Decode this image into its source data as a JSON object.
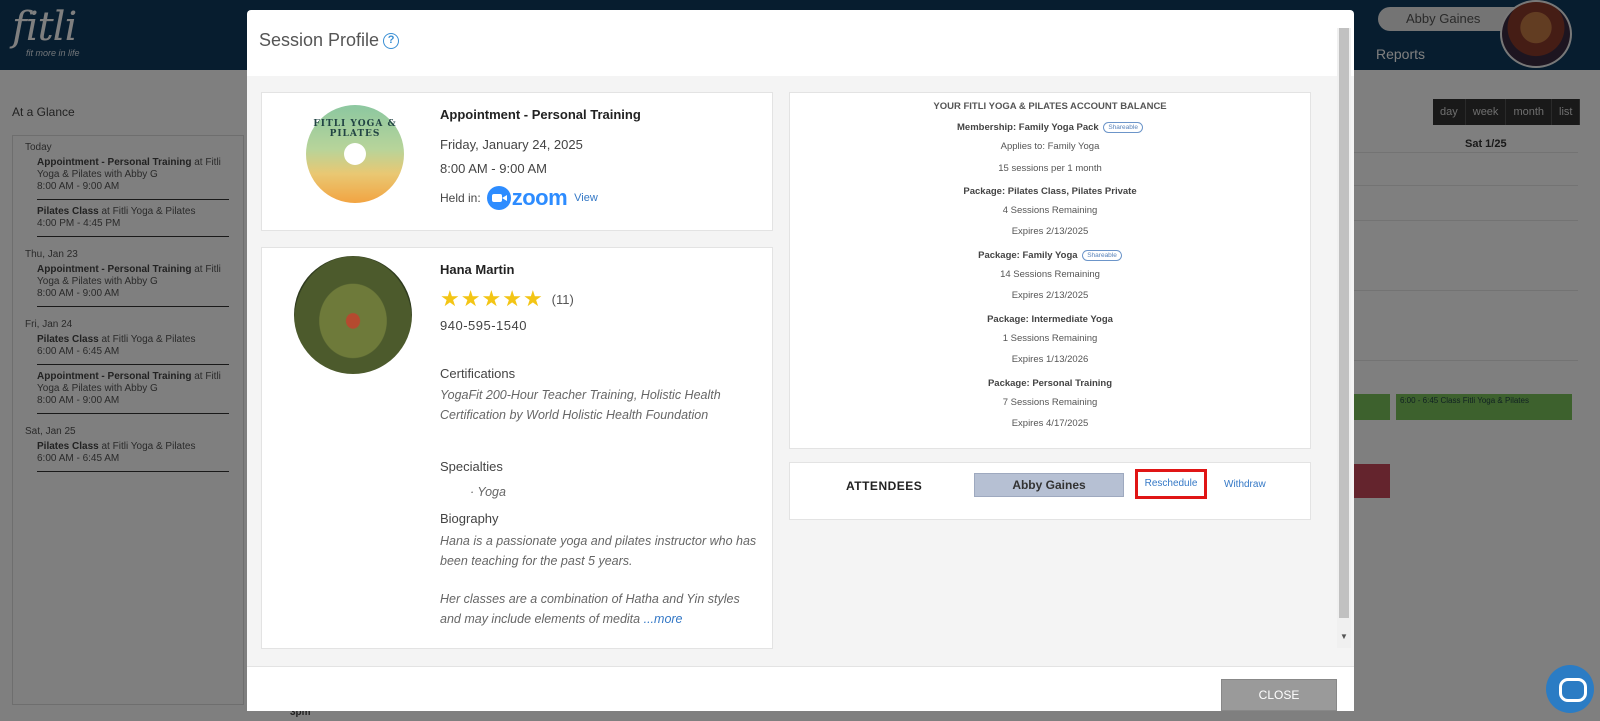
{
  "background": {
    "logo": "fitli",
    "logo_tagline": "fit more in life",
    "user_name": "Abby Gaines",
    "nav_reports": "Reports",
    "at_a_glance": "At a Glance",
    "view_buttons": [
      "day",
      "week",
      "month",
      "list"
    ],
    "calendar_day_header": "Sat 1/25",
    "sidebar": [
      {
        "day": "Today",
        "items": [
          {
            "title": "Appointment - Personal Training",
            "rest": "at Fitli Yoga & Pilates with Abby G",
            "time": "8:00 AM - 9:00 AM"
          },
          {
            "title": "Pilates Class",
            "rest": "at Fitli Yoga & Pilates",
            "time": "4:00 PM - 4:45 PM"
          }
        ]
      },
      {
        "day": "Thu, Jan 23",
        "items": [
          {
            "title": "Appointment - Personal Training",
            "rest": "at Fitli Yoga & Pilates with Abby G",
            "time": "8:00 AM - 9:00 AM"
          }
        ]
      },
      {
        "day": "Fri, Jan 24",
        "items": [
          {
            "title": "Pilates Class",
            "rest": "at Fitli Yoga & Pilates",
            "time": "6:00 AM - 6:45 AM"
          },
          {
            "title": "Appointment - Personal Training",
            "rest": "at Fitli Yoga & Pilates with Abby G",
            "time": "8:00 AM - 9:00 AM"
          }
        ]
      },
      {
        "day": "Sat, Jan 25",
        "items": [
          {
            "title": "Pilates Class",
            "rest": "at Fitli Yoga & Pilates",
            "time": "6:00 AM - 6:45 AM"
          }
        ]
      }
    ],
    "event_green_text": "6:00 - 6:45 Class Fitli Yoga & Pilates",
    "time_label": "3pm"
  },
  "modal": {
    "title": "Session Profile",
    "help_icon": "?",
    "session": {
      "logo_text": "FITLI YOGA & PILATES",
      "title": "Appointment - Personal Training",
      "date": "Friday, January 24, 2025",
      "time": "8:00 AM - 9:00 AM",
      "held_in_label": "Held in:",
      "platform": "zoom",
      "view_label": "View"
    },
    "instructor": {
      "name": "Hana Martin",
      "stars": 5,
      "rating_count": "(11)",
      "phone": "940-595-1540",
      "certifications_label": "Certifications",
      "certifications": "YogaFit 200-Hour Teacher Training, Holistic Health Certification by World Holistic Health Foundation",
      "specialties_label": "Specialties",
      "specialty": "Yoga",
      "biography_label": "Biography",
      "bio_p1": "Hana is a passionate yoga and pilates instructor who has been teaching for the past 5 years.",
      "bio_p2": "Her classes are a combination of Hatha and Yin styles and may include elements of medita",
      "more_label": "...more"
    },
    "balance": {
      "title": "YOUR FITLI YOGA & PILATES ACCOUNT BALANCE",
      "shareable_label": "Shareable",
      "membership": {
        "name": "Membership: Family Yoga Pack",
        "applies": "Applies to: Family Yoga",
        "detail": "15 sessions per 1 month"
      },
      "packages": [
        {
          "name": "Package: Pilates Class, Pilates Private",
          "remaining": "4 Sessions Remaining",
          "expires": "Expires 2/13/2025"
        },
        {
          "name": "Package: Family Yoga",
          "remaining": "14 Sessions Remaining",
          "expires": "Expires 2/13/2025"
        },
        {
          "name": "Package: Intermediate Yoga",
          "remaining": "1 Sessions Remaining",
          "expires": "Expires 1/13/2026"
        },
        {
          "name": "Package: Personal Training",
          "remaining": "7 Sessions Remaining",
          "expires": "Expires 4/17/2025"
        }
      ]
    },
    "attendees": {
      "label": "ATTENDEES",
      "name": "Abby Gaines",
      "reschedule_label": "Reschedule",
      "withdraw_label": "Withdraw"
    },
    "close_label": "CLOSE"
  },
  "colors": {
    "header_bg": "#0f3b5f",
    "link": "#3478c6",
    "highlight_border": "#e01515",
    "star": "#f3c515",
    "attendee_bg": "#b6c0d3",
    "zoom_blue": "#2d8cff"
  }
}
